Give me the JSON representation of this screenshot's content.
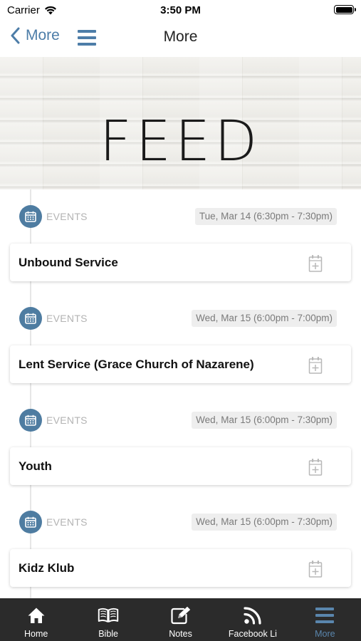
{
  "status_bar": {
    "carrier": "Carrier",
    "time": "3:50 PM"
  },
  "nav": {
    "back_label": "More",
    "title": "More"
  },
  "banner": {
    "text": "FEED"
  },
  "feed": {
    "items": [
      {
        "category": "EVENTS",
        "date": "Tue, Mar 14 (6:30pm - 7:30pm)",
        "title": "Unbound Service"
      },
      {
        "category": "EVENTS",
        "date": "Wed, Mar 15 (6:00pm - 7:00pm)",
        "title": "Lent Service (Grace Church of Nazarene)"
      },
      {
        "category": "EVENTS",
        "date": "Wed, Mar 15 (6:00pm - 7:30pm)",
        "title": "Youth"
      },
      {
        "category": "EVENTS",
        "date": "Wed, Mar 15 (6:00pm - 7:30pm)",
        "title": "Kidz Klub"
      }
    ]
  },
  "tab_bar": {
    "tabs": [
      {
        "label": "Home",
        "icon": "home-icon"
      },
      {
        "label": "Bible",
        "icon": "book-icon"
      },
      {
        "label": "Notes",
        "icon": "notes-icon"
      },
      {
        "label": "Facebook Li",
        "icon": "rss-icon"
      },
      {
        "label": "More",
        "icon": "menu-icon",
        "active": true
      }
    ]
  },
  "colors": {
    "accent": "#4e7ca1",
    "tab_bar": "#2b2b2b",
    "active_tab": "#5a86ad"
  }
}
